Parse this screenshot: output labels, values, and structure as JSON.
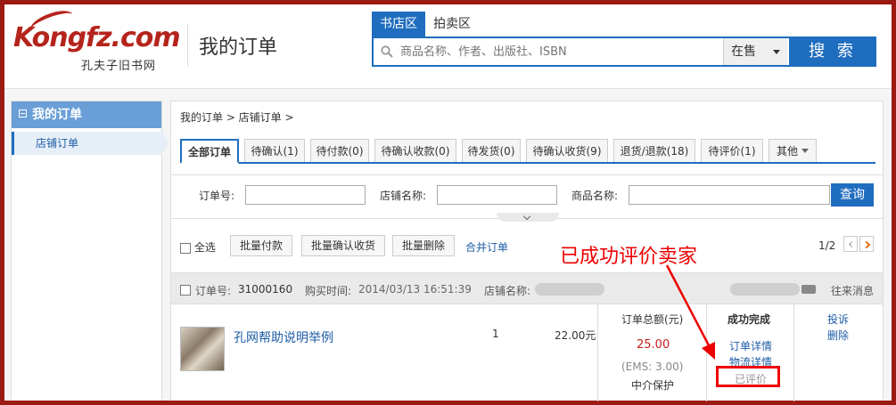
{
  "header": {
    "logo_text": "Kongfz.com",
    "logo_sub": "孔夫子旧书网",
    "title": "我的订单"
  },
  "search": {
    "tabs": [
      "书店区",
      "拍卖区"
    ],
    "placeholder": "商品名称、作者、出版社、ISBN",
    "select_value": "在售",
    "button_label": "搜 索"
  },
  "sidebar": {
    "heading": "我的订单",
    "items": [
      {
        "label": "店铺订单"
      }
    ]
  },
  "breadcrumb": "我的订单 > 店铺订单 >",
  "tabs": [
    {
      "label": "全部订单"
    },
    {
      "label": "待确认(1)"
    },
    {
      "label": "待付款(0)"
    },
    {
      "label": "待确认收款(0)"
    },
    {
      "label": "待发货(0)"
    },
    {
      "label": "待确认收货(9)"
    },
    {
      "label": "退货/退款(18)"
    },
    {
      "label": "待评价(1)"
    },
    {
      "label": "其他"
    }
  ],
  "filter": {
    "order_no_label": "订单号:",
    "shop_name_label": "店铺名称:",
    "product_name_label": "商品名称:",
    "query_button": "查询"
  },
  "toolbar": {
    "select_all": "全选",
    "batch_pay": "批量付款",
    "batch_confirm": "批量确认收货",
    "batch_delete": "批量删除",
    "merge_orders": "合并订单",
    "page": "1/2"
  },
  "order": {
    "order_no_label": "订单号:",
    "order_no": "31000160",
    "time_label": "购买时间:",
    "time": "2014/03/13 16:51:39",
    "shop_label": "店铺名称:",
    "contact_link": "往来消息",
    "product_title": "孔网帮助说明举例",
    "quantity": "1",
    "price": "22.00元",
    "total_label": "订单总额(元)",
    "total": "25.00",
    "shipping": "(EMS: 3.00)",
    "escrow": "中介保护",
    "status": "成功完成",
    "detail_link": "订单详情",
    "logistics_link": "物流详情",
    "reviewed": "已评价",
    "complain_link": "投诉",
    "delete_link": "删除"
  },
  "annotation": "已成功评价卖家",
  "colors": {
    "primary_blue": "#1f6dbf",
    "brand_red": "#b5241c",
    "annotation_red": "#e00000",
    "frame": "#9b1a13"
  }
}
